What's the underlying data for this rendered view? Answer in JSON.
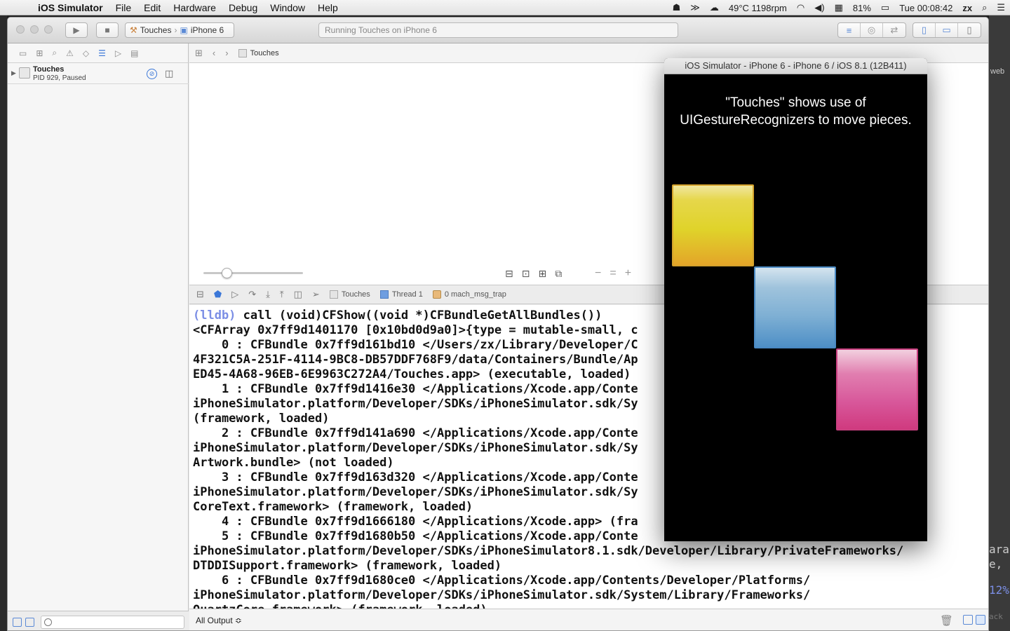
{
  "menubar": {
    "app_name": "iOS Simulator",
    "items": [
      "File",
      "Edit",
      "Hardware",
      "Debug",
      "Window",
      "Help"
    ],
    "temp": "49°C 1198rpm",
    "battery": "81%",
    "clock": "Tue 00:08:42",
    "user": "zx"
  },
  "toolbar": {
    "scheme_target": "Touches",
    "scheme_device": "iPhone 6",
    "status_text": "Running Touches on iPhone 6"
  },
  "navigator": {
    "process_name": "Touches",
    "process_status": "PID 929, Paused"
  },
  "jumpbar": {
    "crumb": "Touches"
  },
  "debugbar": {
    "crumbs": [
      "Touches",
      "Thread 1",
      "0 mach_msg_trap"
    ]
  },
  "console": {
    "prompt": "(lldb)",
    "command": " call (void)CFShow((void *)CFBundleGetAllBundles())",
    "lines": [
      "<CFArray 0x7ff9d1401170 [0x10bd0d9a0]>{type = mutable-small, c",
      "    0 : CFBundle 0x7ff9d161bd10 </Users/zx/Library/Developer/C",
      "4F321C5A-251F-4114-9BC8-DB57DDF768F9/data/Containers/Bundle/Ap",
      "ED45-4A68-96EB-6E9963C272A4/Touches.app> (executable, loaded)",
      "    1 : CFBundle 0x7ff9d1416e30 </Applications/Xcode.app/Conte",
      "iPhoneSimulator.platform/Developer/SDKs/iPhoneSimulator.sdk/Sy                                 ework>",
      "(framework, loaded)",
      "    2 : CFBundle 0x7ff9d141a690 </Applications/Xcode.app/Conte",
      "iPhoneSimulator.platform/Developer/SDKs/iPhoneSimulator.sdk/Sy                                 ework/",
      "Artwork.bundle> (not loaded)",
      "    3 : CFBundle 0x7ff9d163d320 </Applications/Xcode.app/Conte",
      "iPhoneSimulator.platform/Developer/SDKs/iPhoneSimulator.sdk/Sy",
      "CoreText.framework> (framework, loaded)",
      "    4 : CFBundle 0x7ff9d1666180 </Applications/Xcode.app> (fra",
      "    5 : CFBundle 0x7ff9d1680b50 </Applications/Xcode.app/Conte",
      "iPhoneSimulator.platform/Developer/SDKs/iPhoneSimulator8.1.sdk/Developer/Library/PrivateFrameworks/",
      "DTDDISupport.framework> (framework, loaded)",
      "    6 : CFBundle 0x7ff9d1680ce0 </Applications/Xcode.app/Contents/Developer/Platforms/",
      "iPhoneSimulator.platform/Developer/SDKs/iPhoneSimulator.sdk/System/Library/Frameworks/",
      "QuartzCore.framework> (framework, loaded)"
    ],
    "output_selector": "All Output ≎"
  },
  "simulator": {
    "title": "iOS Simulator - iPhone 6 - iPhone 6 / iOS 8.1 (12B411)",
    "message_line1": "\"Touches\" shows use of",
    "message_line2": "UIGestureRecognizers to move pieces."
  },
  "background": {
    "right_frag1": "web",
    "right_frag2": "ara",
    "right_frag3": "e,",
    "right_frag4": "12%",
    "right_frag5": "ack"
  },
  "colors": {
    "accent_blue": "#3b77d8",
    "lldb_prompt": "#7b8ee5",
    "piece_yellow": "#e0d32a",
    "piece_blue": "#7fb0d4",
    "piece_pink": "#d8589b"
  }
}
